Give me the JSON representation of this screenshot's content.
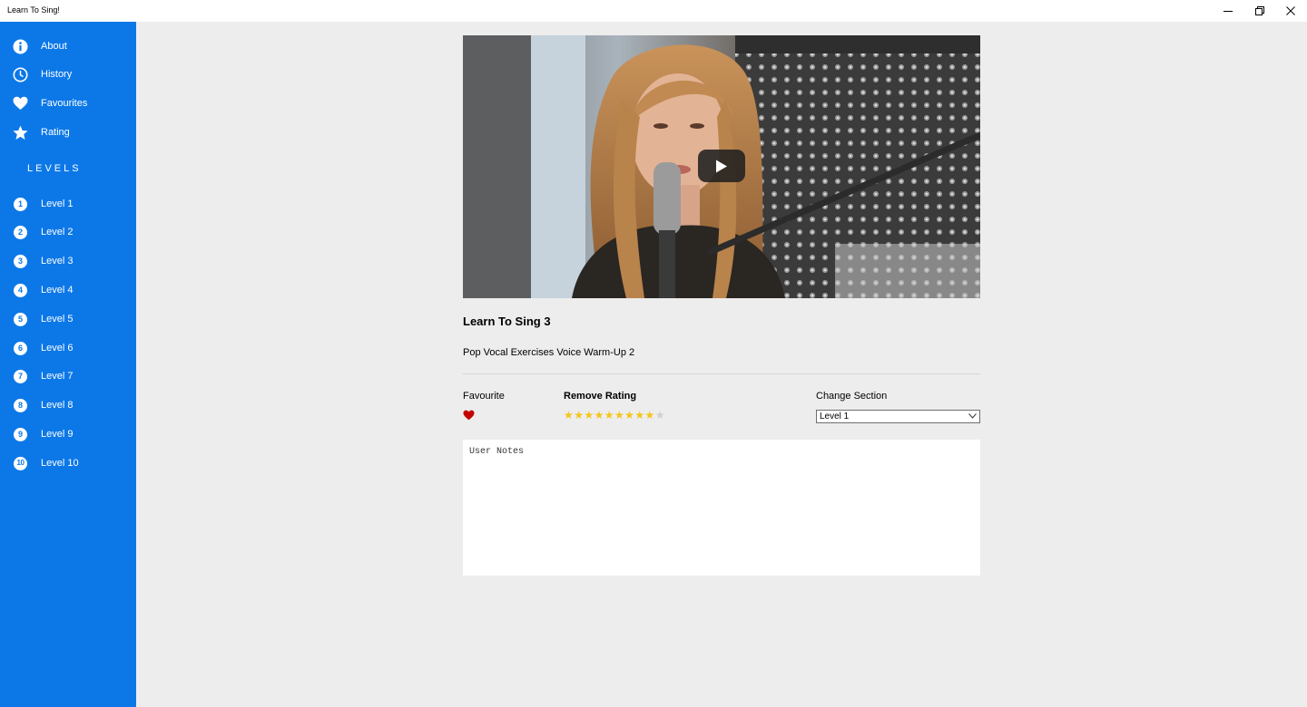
{
  "window": {
    "title": "Learn To Sing!"
  },
  "sidebar": {
    "items": [
      {
        "label": "About",
        "icon": "info-icon"
      },
      {
        "label": "History",
        "icon": "clock-icon"
      },
      {
        "label": "Favourites",
        "icon": "heart-icon"
      },
      {
        "label": "Rating",
        "icon": "star-icon"
      }
    ],
    "levels_heading": "LEVELS",
    "levels": [
      {
        "num": "1",
        "label": "Level 1"
      },
      {
        "num": "2",
        "label": "Level 2"
      },
      {
        "num": "3",
        "label": "Level 3"
      },
      {
        "num": "4",
        "label": "Level 4"
      },
      {
        "num": "5",
        "label": "Level 5"
      },
      {
        "num": "6",
        "label": "Level 6"
      },
      {
        "num": "7",
        "label": "Level 7"
      },
      {
        "num": "8",
        "label": "Level 8"
      },
      {
        "num": "9",
        "label": "Level 9"
      },
      {
        "num": "10",
        "label": "Level 10"
      }
    ]
  },
  "video": {
    "title": "Learn To Sing 3",
    "subtitle": "Pop Vocal Exercises Voice Warm-Up 2"
  },
  "favourite": {
    "label": "Favourite",
    "is_favourite": true
  },
  "rating": {
    "label": "Remove Rating",
    "value": 9,
    "max": 10
  },
  "section": {
    "label": "Change Section",
    "selected": "Level 1"
  },
  "notes": {
    "placeholder": "User Notes"
  },
  "colors": {
    "sidebar": "#0c78e8",
    "background": "#ededed",
    "star_filled": "#f5c518",
    "star_empty": "#cfcfcf",
    "heart": "#c40000"
  }
}
